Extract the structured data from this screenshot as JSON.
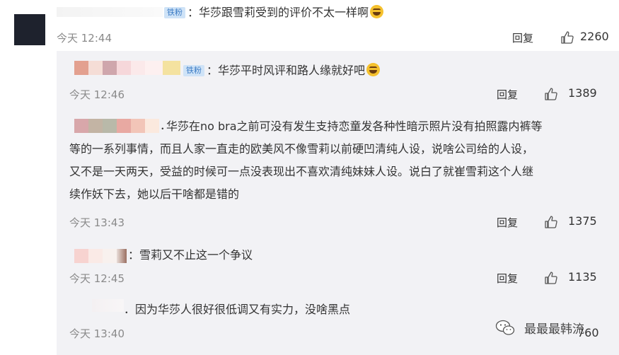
{
  "comments": [
    {
      "badge": "铁粉",
      "text": "：华莎跟雪莉受到的评价不太一样啊",
      "emoji": "laugh-cry-emoji",
      "time": "今天 12:44",
      "reply": "回复",
      "likes": "2260"
    },
    {
      "badge": "铁粉",
      "text": "：华莎平时风评和路人缘就好吧",
      "emoji": "laugh-cry-emoji",
      "time": "今天 12:46",
      "reply": "回复",
      "likes": "1389"
    },
    {
      "lead": "．",
      "lines": [
        "华莎在no bra之前可没有发生支持恋童发各种性暗示照片没有拍照露内裤等",
        "等的一系列事情，而且人家一直走的欧美风不像雪莉以前硬凹清纯人设，说啥公司给的人设，",
        "又不是一天两天，受益的时候可一点没表现出不喜欢清纯妹妹人设。说白了就崔雪莉这个人继",
        "续作妖下去，她以后干啥都是错的"
      ],
      "time": "今天 13:43",
      "reply": "回复",
      "likes": "1375"
    },
    {
      "text": "：雪莉又不止这一个争议",
      "time": "今天 12:45",
      "reply": "回复",
      "likes": "1135"
    },
    {
      "text": "．因为华莎人很好很低调又有实力，没啥黑点",
      "time": "今天 13:40",
      "likes": "760"
    }
  ],
  "watermark": "最最最韩流",
  "colors": {
    "panel_bg": "#f2f2f5",
    "badge_bg": "#cfe3f7",
    "badge_text": "#3c7cc5",
    "time_text": "#8a8a8a"
  }
}
